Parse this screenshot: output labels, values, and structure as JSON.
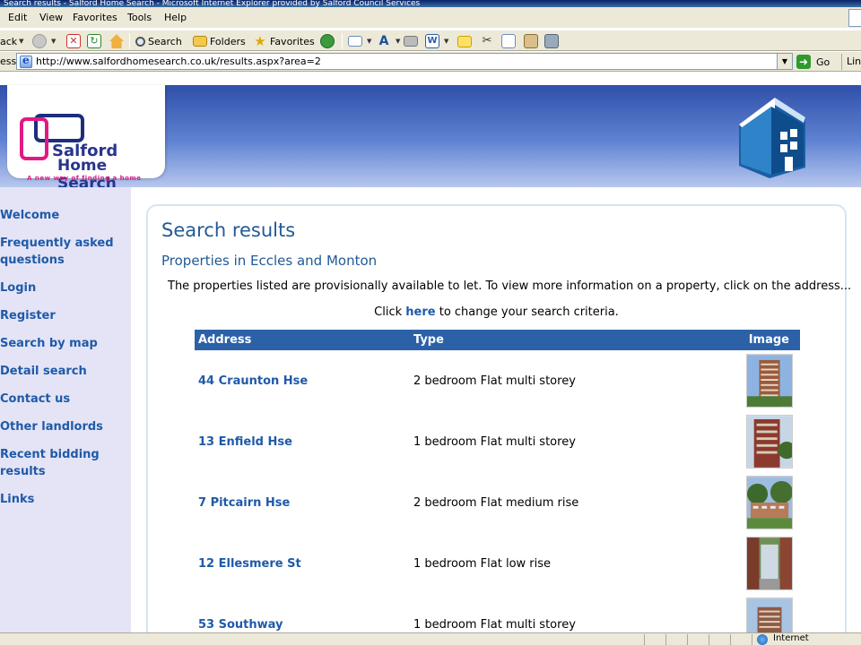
{
  "window": {
    "title": "Search results - Salford Home Search - Microsoft Internet Explorer provided by Salford Council Services"
  },
  "menu": {
    "items": [
      {
        "label": "Edit"
      },
      {
        "label": "View"
      },
      {
        "label": "Favorites"
      },
      {
        "label": "Tools"
      },
      {
        "label": "Help"
      }
    ]
  },
  "toolbar": {
    "back_label": "ack",
    "search_label": "Search",
    "folders_label": "Folders",
    "favorites_label": "Favorites"
  },
  "addressbar": {
    "label": "ess",
    "url": "http://www.salfordhomesearch.co.uk/results.aspx?area=2",
    "go_label": "Go",
    "links_label": "Lin"
  },
  "logo": {
    "line1": "Salford",
    "line2": "Home Search",
    "tagline": "A new way of finding a home"
  },
  "sidebar": {
    "items": [
      {
        "label": "Welcome"
      },
      {
        "label": "Frequently asked questions"
      },
      {
        "label": "Login"
      },
      {
        "label": "Register"
      },
      {
        "label": "Search by map"
      },
      {
        "label": "Detail search"
      },
      {
        "label": "Contact us"
      },
      {
        "label": "Other landlords"
      },
      {
        "label": "Recent bidding results"
      },
      {
        "label": "Links"
      }
    ]
  },
  "main": {
    "title": "Search results",
    "subtitle": "Properties in Eccles and Monton",
    "intro": "The properties listed are provisionally available to let. To view more information on a property, click on the address...",
    "criteria_prefix": "Click ",
    "criteria_link": "here",
    "criteria_suffix": " to change your search criteria.",
    "table": {
      "headers": {
        "address": "Address",
        "type": "Type",
        "image": "Image"
      },
      "rows": [
        {
          "address": "44 Craunton Hse",
          "type": "2 bedroom Flat multi storey"
        },
        {
          "address": "13 Enfield Hse",
          "type": "1 bedroom Flat multi storey"
        },
        {
          "address": "7 Pitcairn Hse",
          "type": "2 bedroom Flat medium rise"
        },
        {
          "address": "12 Ellesmere St",
          "type": "1 bedroom Flat low rise"
        },
        {
          "address": "53 Southway",
          "type": "1 bedroom Flat multi storey"
        }
      ]
    }
  },
  "statusbar": {
    "zone": "Internet"
  },
  "colors": {
    "accent": "#2c61a8",
    "link": "#1f5aa8",
    "logo_pink": "#e01a84",
    "logo_navy": "#27358b"
  }
}
